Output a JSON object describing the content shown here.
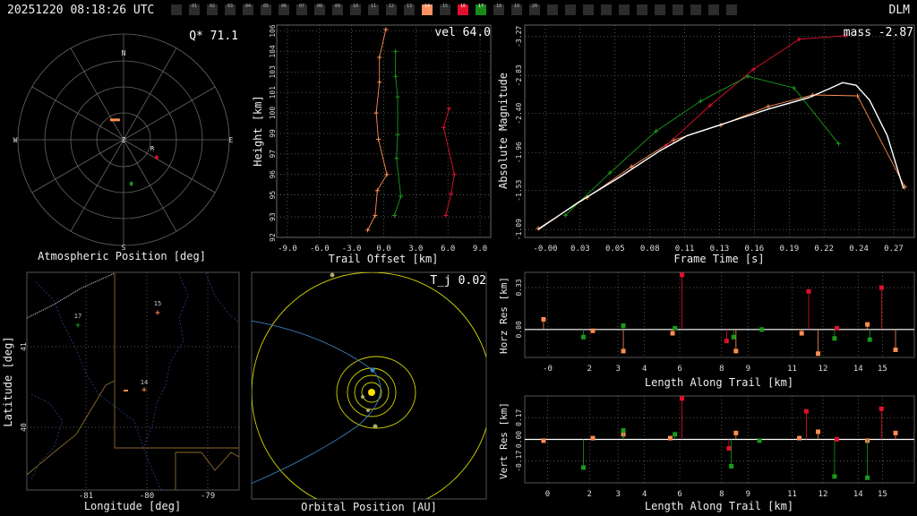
{
  "header": {
    "title": "20251220 08:18:26 UTC",
    "station": "DLM"
  },
  "strip": {
    "labels": [
      "01",
      "02",
      "03",
      "04",
      "05",
      "06",
      "07",
      "08",
      "09",
      "10",
      "11",
      "12",
      "13",
      "14",
      "15",
      "16",
      "17",
      "18",
      "19",
      "20"
    ],
    "highlight": {
      "14": "#ff9060",
      "16": "#e0102c",
      "17": "#1a8a1a"
    }
  },
  "colors": {
    "orange": "#ff8c50",
    "red": "#e0102c",
    "green": "#1a9a1a",
    "white": "#ffffff",
    "yellow": "#d4d400",
    "blue": "#3a80c0"
  },
  "polar": {
    "title": "Atmospheric Position [deg]",
    "badge": "Q* 71.1",
    "cardinals": {
      "N": "N",
      "E": "E",
      "S": "S",
      "W": "W",
      "Z": "Z",
      "R": "R"
    }
  },
  "trail": {
    "title": "Trail Offset [km]",
    "ylabel": "Height [km]",
    "badge": "vel 64.0",
    "xticks": [
      "-9.0",
      "-6.0",
      "-3.0",
      "0.0",
      "3.0",
      "6.0",
      "9.0"
    ],
    "yticks": [
      "92",
      "93",
      "95",
      "96",
      "97",
      "99",
      "100",
      "101",
      "103",
      "104",
      "106"
    ]
  },
  "mag": {
    "title": "Frame Time [s]",
    "ylabel": "Absolute Magnitude",
    "badge": "mass -2.87",
    "xticks": [
      "-0.00",
      "0.03",
      "0.05",
      "0.08",
      "0.11",
      "0.13",
      "0.16",
      "0.19",
      "0.22",
      "0.24",
      "0.27"
    ],
    "yticks": [
      "-3.27",
      "-2.83",
      "-2.40",
      "-1.96",
      "-1.53",
      "-1.09"
    ]
  },
  "map": {
    "title": "Longitude [deg]",
    "ylabel": "Latitude [deg]",
    "xticks": [
      "-81",
      "-80",
      "-79"
    ],
    "yticks": [
      "41",
      "40"
    ],
    "station_labels": [
      "17",
      "15",
      "14"
    ]
  },
  "orbit": {
    "title": "Orbital Position [AU]",
    "badge": "T_j 0.02"
  },
  "horz": {
    "title": "Length Along Trail [km]",
    "ylabel": "Horz Res [km]",
    "xticks": [
      "-0",
      "2",
      "3",
      "4",
      "6",
      "8",
      "9",
      "11",
      "12",
      "14",
      "15"
    ],
    "yticks": [
      "0.33",
      "0.00"
    ]
  },
  "vert": {
    "title": "Length Along Trail [km]",
    "ylabel": "Vert Res [km]",
    "xticks": [
      "0",
      "2",
      "3",
      "4",
      "6",
      "8",
      "9",
      "11",
      "12",
      "14",
      "15"
    ],
    "yticks": [
      "0.17",
      "0.00",
      "-0.17"
    ]
  },
  "chart_data": [
    {
      "type": "scatter",
      "title": "Atmospheric Position [deg]",
      "series": [
        {
          "name": "14",
          "values": [
            [
              -20,
              72
            ]
          ]
        },
        {
          "name": "16",
          "values": [
            [
              118,
              58
            ]
          ]
        },
        {
          "name": "17",
          "values": [
            [
              170,
              52
            ]
          ]
        }
      ]
    },
    {
      "type": "line",
      "xlabel": "Trail Offset [km]",
      "ylabel": "Height [km]",
      "xlim": [
        -10,
        10
      ],
      "ylim": [
        92,
        106.5
      ],
      "series": [
        {
          "name": "14",
          "points": [
            [
              -1.5,
              92.5
            ],
            [
              -0.8,
              93.5
            ],
            [
              -0.6,
              95.2
            ],
            [
              0.3,
              96.3
            ],
            [
              -0.5,
              98.7
            ],
            [
              -0.7,
              100.5
            ],
            [
              -0.4,
              102.6
            ],
            [
              -0.4,
              104.3
            ],
            [
              0.2,
              106.2
            ]
          ]
        },
        {
          "name": "16",
          "points": [
            [
              5.8,
              93.5
            ],
            [
              6.3,
              95.0
            ],
            [
              6.6,
              96.3
            ],
            [
              5.6,
              99.5
            ],
            [
              6.1,
              100.8
            ]
          ]
        },
        {
          "name": "17",
          "points": [
            [
              1.0,
              93.5
            ],
            [
              1.6,
              94.8
            ],
            [
              1.2,
              97.4
            ],
            [
              1.3,
              99.0
            ],
            [
              1.3,
              101.6
            ],
            [
              1.1,
              103.0
            ],
            [
              1.1,
              104.7
            ]
          ]
        }
      ]
    },
    {
      "type": "line",
      "xlabel": "Frame Time [s]",
      "ylabel": "Absolute Magnitude",
      "xlim": [
        -0.01,
        0.278
      ],
      "ylim": [
        -1.0,
        -3.4
      ],
      "series": [
        {
          "name": "14",
          "points": [
            [
              0.0,
              -1.1
            ],
            [
              0.036,
              -1.45
            ],
            [
              0.069,
              -1.8
            ],
            [
              0.1,
              -2.1
            ],
            [
              0.135,
              -2.27
            ],
            [
              0.17,
              -2.48
            ],
            [
              0.203,
              -2.61
            ],
            [
              0.236,
              -2.6
            ],
            [
              0.271,
              -1.57
            ]
          ]
        },
        {
          "name": "16",
          "points": [
            [
              0.094,
              -2.03
            ],
            [
              0.127,
              -2.49
            ],
            [
              0.159,
              -2.9
            ],
            [
              0.193,
              -3.24
            ],
            [
              0.227,
              -3.28
            ]
          ]
        },
        {
          "name": "17",
          "points": [
            [
              0.02,
              -1.25
            ],
            [
              0.053,
              -1.73
            ],
            [
              0.087,
              -2.2
            ],
            [
              0.12,
              -2.54
            ],
            [
              0.155,
              -2.82
            ],
            [
              0.189,
              -2.69
            ],
            [
              0.222,
              -2.06
            ]
          ]
        },
        {
          "name": "fit",
          "points": [
            [
              0.0,
              -1.09
            ],
            [
              0.03,
              -1.4
            ],
            [
              0.06,
              -1.68
            ],
            [
              0.09,
              -1.98
            ],
            [
              0.11,
              -2.15
            ],
            [
              0.14,
              -2.3
            ],
            [
              0.17,
              -2.45
            ],
            [
              0.2,
              -2.58
            ],
            [
              0.215,
              -2.68
            ],
            [
              0.225,
              -2.75
            ],
            [
              0.235,
              -2.72
            ],
            [
              0.245,
              -2.55
            ],
            [
              0.258,
              -2.15
            ],
            [
              0.27,
              -1.55
            ]
          ]
        }
      ]
    },
    {
      "type": "bar",
      "xlabel": "Length Along Trail [km]",
      "ylabel": "Horz Res [km]",
      "xlim": [
        -0.8,
        15.8
      ],
      "ylim": [
        -0.22,
        0.45
      ],
      "series": [
        {
          "name": "14",
          "points": [
            [
              -0.0,
              0.08
            ],
            [
              2.1,
              -0.01
            ],
            [
              3.4,
              -0.17
            ],
            [
              5.5,
              -0.03
            ],
            [
              8.2,
              -0.17
            ],
            [
              11.0,
              -0.03
            ],
            [
              11.7,
              -0.19
            ],
            [
              13.8,
              0.04
            ],
            [
              15.0,
              -0.16
            ]
          ]
        },
        {
          "name": "16",
          "points": [
            [
              5.9,
              0.43
            ],
            [
              7.8,
              -0.09
            ],
            [
              11.3,
              0.3
            ],
            [
              12.5,
              0.01
            ],
            [
              14.4,
              0.33
            ]
          ]
        },
        {
          "name": "17",
          "points": [
            [
              1.7,
              -0.06
            ],
            [
              3.4,
              0.03
            ],
            [
              5.6,
              0.01
            ],
            [
              8.1,
              -0.06
            ],
            [
              9.3,
              0.0
            ],
            [
              12.4,
              -0.07
            ],
            [
              13.9,
              -0.08
            ]
          ]
        }
      ]
    },
    {
      "type": "bar",
      "xlabel": "Length Along Trail [km]",
      "ylabel": "Vert Res [km]",
      "xlim": [
        -0.8,
        15.8
      ],
      "ylim": [
        -0.34,
        0.34
      ],
      "series": [
        {
          "name": "14",
          "points": [
            [
              0.0,
              -0.01
            ],
            [
              2.1,
              0.01
            ],
            [
              3.4,
              0.04
            ],
            [
              5.4,
              0.01
            ],
            [
              8.2,
              0.05
            ],
            [
              10.9,
              0.01
            ],
            [
              11.7,
              0.06
            ],
            [
              13.8,
              -0.01
            ],
            [
              15.0,
              0.05
            ]
          ]
        },
        {
          "name": "16",
          "points": [
            [
              5.9,
              0.32
            ],
            [
              7.9,
              -0.07
            ],
            [
              11.2,
              0.22
            ],
            [
              12.5,
              0.0
            ],
            [
              14.4,
              0.24
            ]
          ]
        },
        {
          "name": "17",
          "points": [
            [
              1.7,
              -0.22
            ],
            [
              3.4,
              0.07
            ],
            [
              5.6,
              0.04
            ],
            [
              8.0,
              -0.21
            ],
            [
              9.2,
              -0.01
            ],
            [
              12.4,
              -0.29
            ],
            [
              13.8,
              -0.3
            ]
          ]
        }
      ]
    }
  ]
}
